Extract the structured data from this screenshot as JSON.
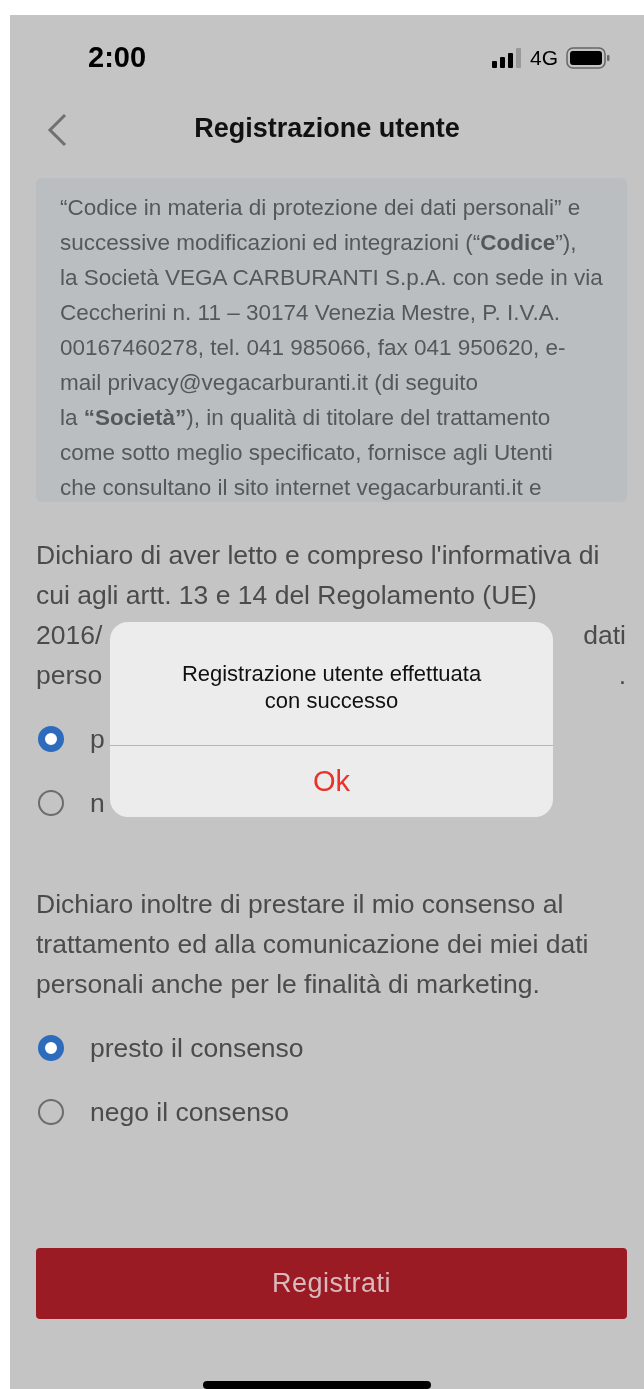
{
  "status_bar": {
    "time": "2:00",
    "network": "4G"
  },
  "nav": {
    "title": "Registrazione utente"
  },
  "privacy_text": "“Codice in materia di protezione dei dati personali” e\nsuccessive modificazioni ed integrazioni (“**Codice**”),\nla Società VEGA CARBURANTI S.p.A. con sede in via\nCeccherini n. 11 – 30174 Venezia Mestre, P. I.V.A.\n00167460278, tel. 041 985066, fax 041 950620, e-\nmail privacy@vegacarburanti.it (di seguito\nla **“Società”**), in qualità di titolare del trattamento\ncome sotto meglio specificato, fornisce agli Utenti\nche consultano il sito internet vegacarburanti.it e",
  "consent_1": {
    "text": "Dichiaro di aver letto e compreso l'informativa di\ncui agli artt. 13 e 14 del Regolamento (UE)",
    "covered_lines": [
      {
        "left": "2016/",
        "right": "dati"
      },
      {
        "left": "perso",
        "right": "."
      }
    ],
    "options": [
      {
        "label": "p",
        "selected": true
      },
      {
        "label": "n",
        "selected": false
      }
    ]
  },
  "consent_2": {
    "text": "Dichiaro inoltre di prestare il mio consenso al\ntrattamento ed alla comunicazione dei miei dati\npersonali anche per le finalità di marketing.",
    "options": [
      {
        "label": "presto il consenso",
        "selected": true
      },
      {
        "label": "nego il consenso",
        "selected": false
      }
    ]
  },
  "submit_button": "Registrati",
  "dialog": {
    "message": "Registrazione utente effettuata\ncon successo",
    "button": "Ok"
  }
}
